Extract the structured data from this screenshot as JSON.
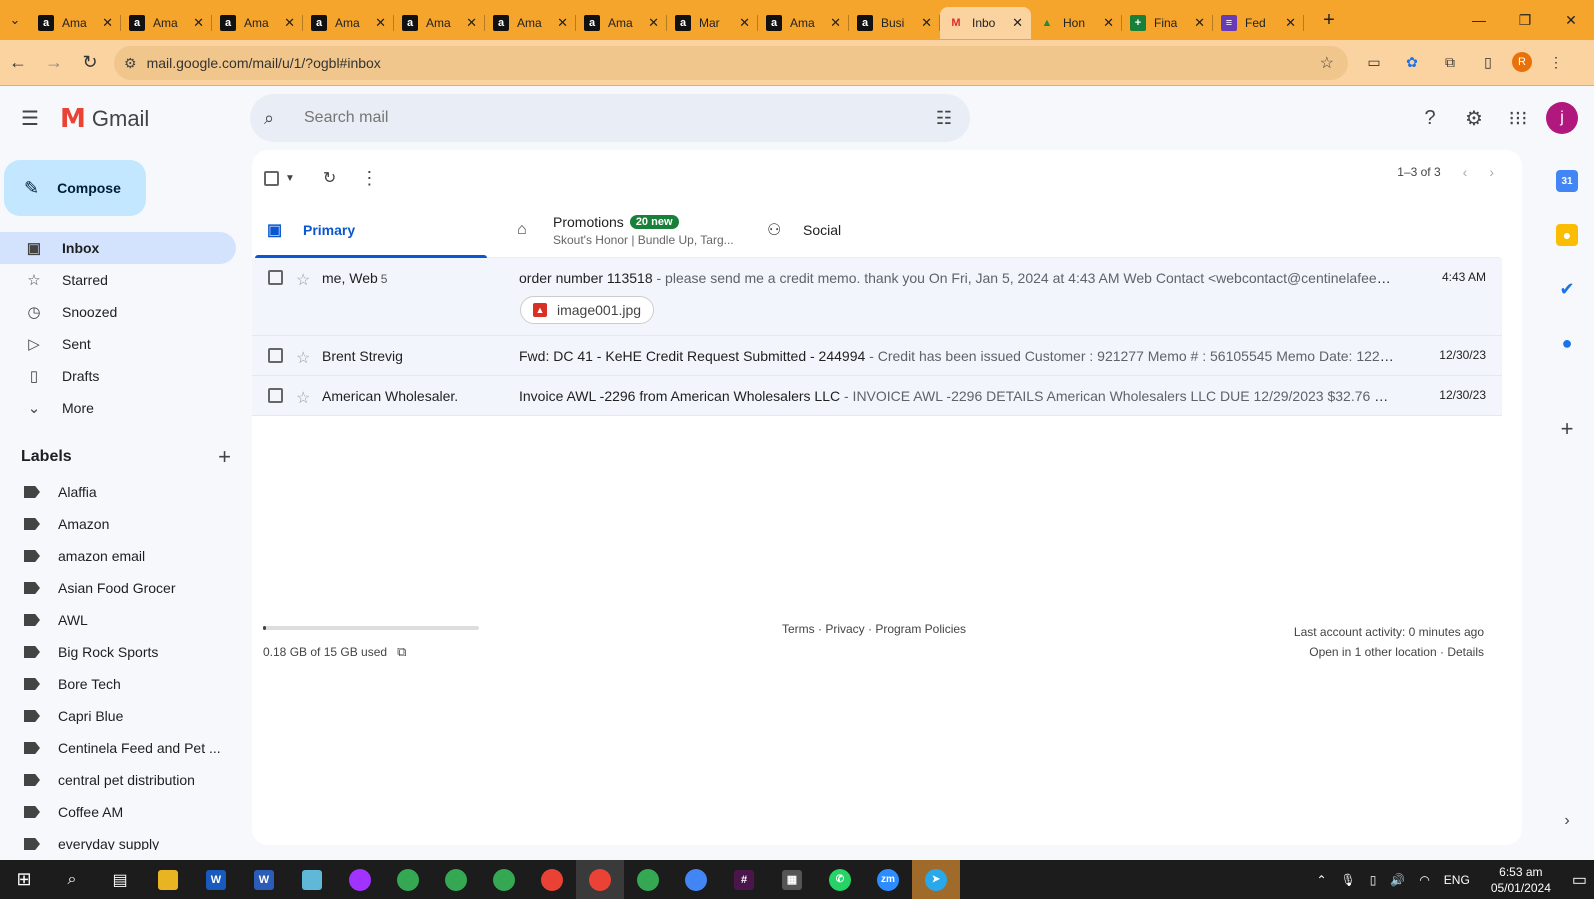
{
  "browser": {
    "tabs": [
      {
        "label": "Ama",
        "icon": "amazon-icon"
      },
      {
        "label": "Ama",
        "icon": "amazon-icon"
      },
      {
        "label": "Ama",
        "icon": "amazon-icon"
      },
      {
        "label": "Ama",
        "icon": "amazon-icon"
      },
      {
        "label": "Ama",
        "icon": "amazon-icon"
      },
      {
        "label": "Ama",
        "icon": "amazon-icon"
      },
      {
        "label": "Ama",
        "icon": "amazon-icon"
      },
      {
        "label": "Mar",
        "icon": "amazon-icon"
      },
      {
        "label": "Ama",
        "icon": "amazon-icon"
      },
      {
        "label": "Busi",
        "icon": "amazon-icon"
      },
      {
        "label": "Inbo",
        "icon": "gmail-icon"
      },
      {
        "label": "Hon",
        "icon": "drive-icon"
      },
      {
        "label": "Fina",
        "icon": "sheets-icon"
      },
      {
        "label": "Fed",
        "icon": "forms-icon"
      }
    ],
    "url": "mail.google.com/mail/u/1/?ogbl#inbox",
    "profile_initial": "R",
    "accent": "#f6a52c"
  },
  "gmail": {
    "brand": "Gmail",
    "search_placeholder": "Search mail",
    "avatar_initial": "j",
    "compose_label": "Compose",
    "nav": [
      {
        "label": "Inbox",
        "icon": "inbox-icon"
      },
      {
        "label": "Starred",
        "icon": "star-icon"
      },
      {
        "label": "Snoozed",
        "icon": "clock-icon"
      },
      {
        "label": "Sent",
        "icon": "send-icon"
      },
      {
        "label": "Drafts",
        "icon": "draft-icon"
      },
      {
        "label": "More",
        "icon": "chevron-down-icon"
      }
    ],
    "labels_heading": "Labels",
    "labels": [
      "Alaffia",
      "Amazon",
      "amazon email",
      "Asian Food Grocer",
      "AWL",
      "Big Rock Sports",
      "Bore Tech",
      "Capri Blue",
      "Centinela Feed and Pet ...",
      "central pet distribution",
      "Coffee AM",
      "everyday supply"
    ],
    "pager": "1–3 of 3",
    "tabs": {
      "primary": "Primary",
      "promotions": "Promotions",
      "promotions_badge": "20 new",
      "promotions_sub": "Skout's Honor | Bundle Up, Targ...",
      "social": "Social"
    },
    "emails": [
      {
        "sender": "me, Web",
        "count": "5",
        "subject": "order number 113518",
        "snippet": " - please send me a credit memo. thank you On Fri, Jan 5, 2024 at 4:43 AM Web Contact <webcontact@centinelafeed....",
        "date": "4:43 AM",
        "attachment": "image001.jpg"
      },
      {
        "sender": "Brent Strevig",
        "count": "",
        "subject": "Fwd: DC 41 - KeHE Credit Request Submitted - 244994",
        "snippet": " - Credit has been issued Customer : 921277 Memo # : 56105545 Memo Date: 12292...",
        "date": "12/30/23"
      },
      {
        "sender": "American Wholesaler.",
        "count": "",
        "subject": "Invoice AWL -2296 from American Wholesalers LLC",
        "snippet": " - INVOICE AWL -2296 DETAILS American Wholesalers LLC DUE 12/29/2023 $32.76 Revi...",
        "date": "12/30/23"
      }
    ],
    "footer": {
      "storage": "0.18 GB of 15 GB used",
      "storage_fraction": 0.012,
      "links": "Terms · Privacy · Program Policies",
      "activity": "Last account activity: 0 minutes ago",
      "other_location": "Open in 1 other location · Details"
    }
  },
  "taskbar": {
    "language": "ENG",
    "time": "6:53 am",
    "date": "05/01/2024"
  }
}
